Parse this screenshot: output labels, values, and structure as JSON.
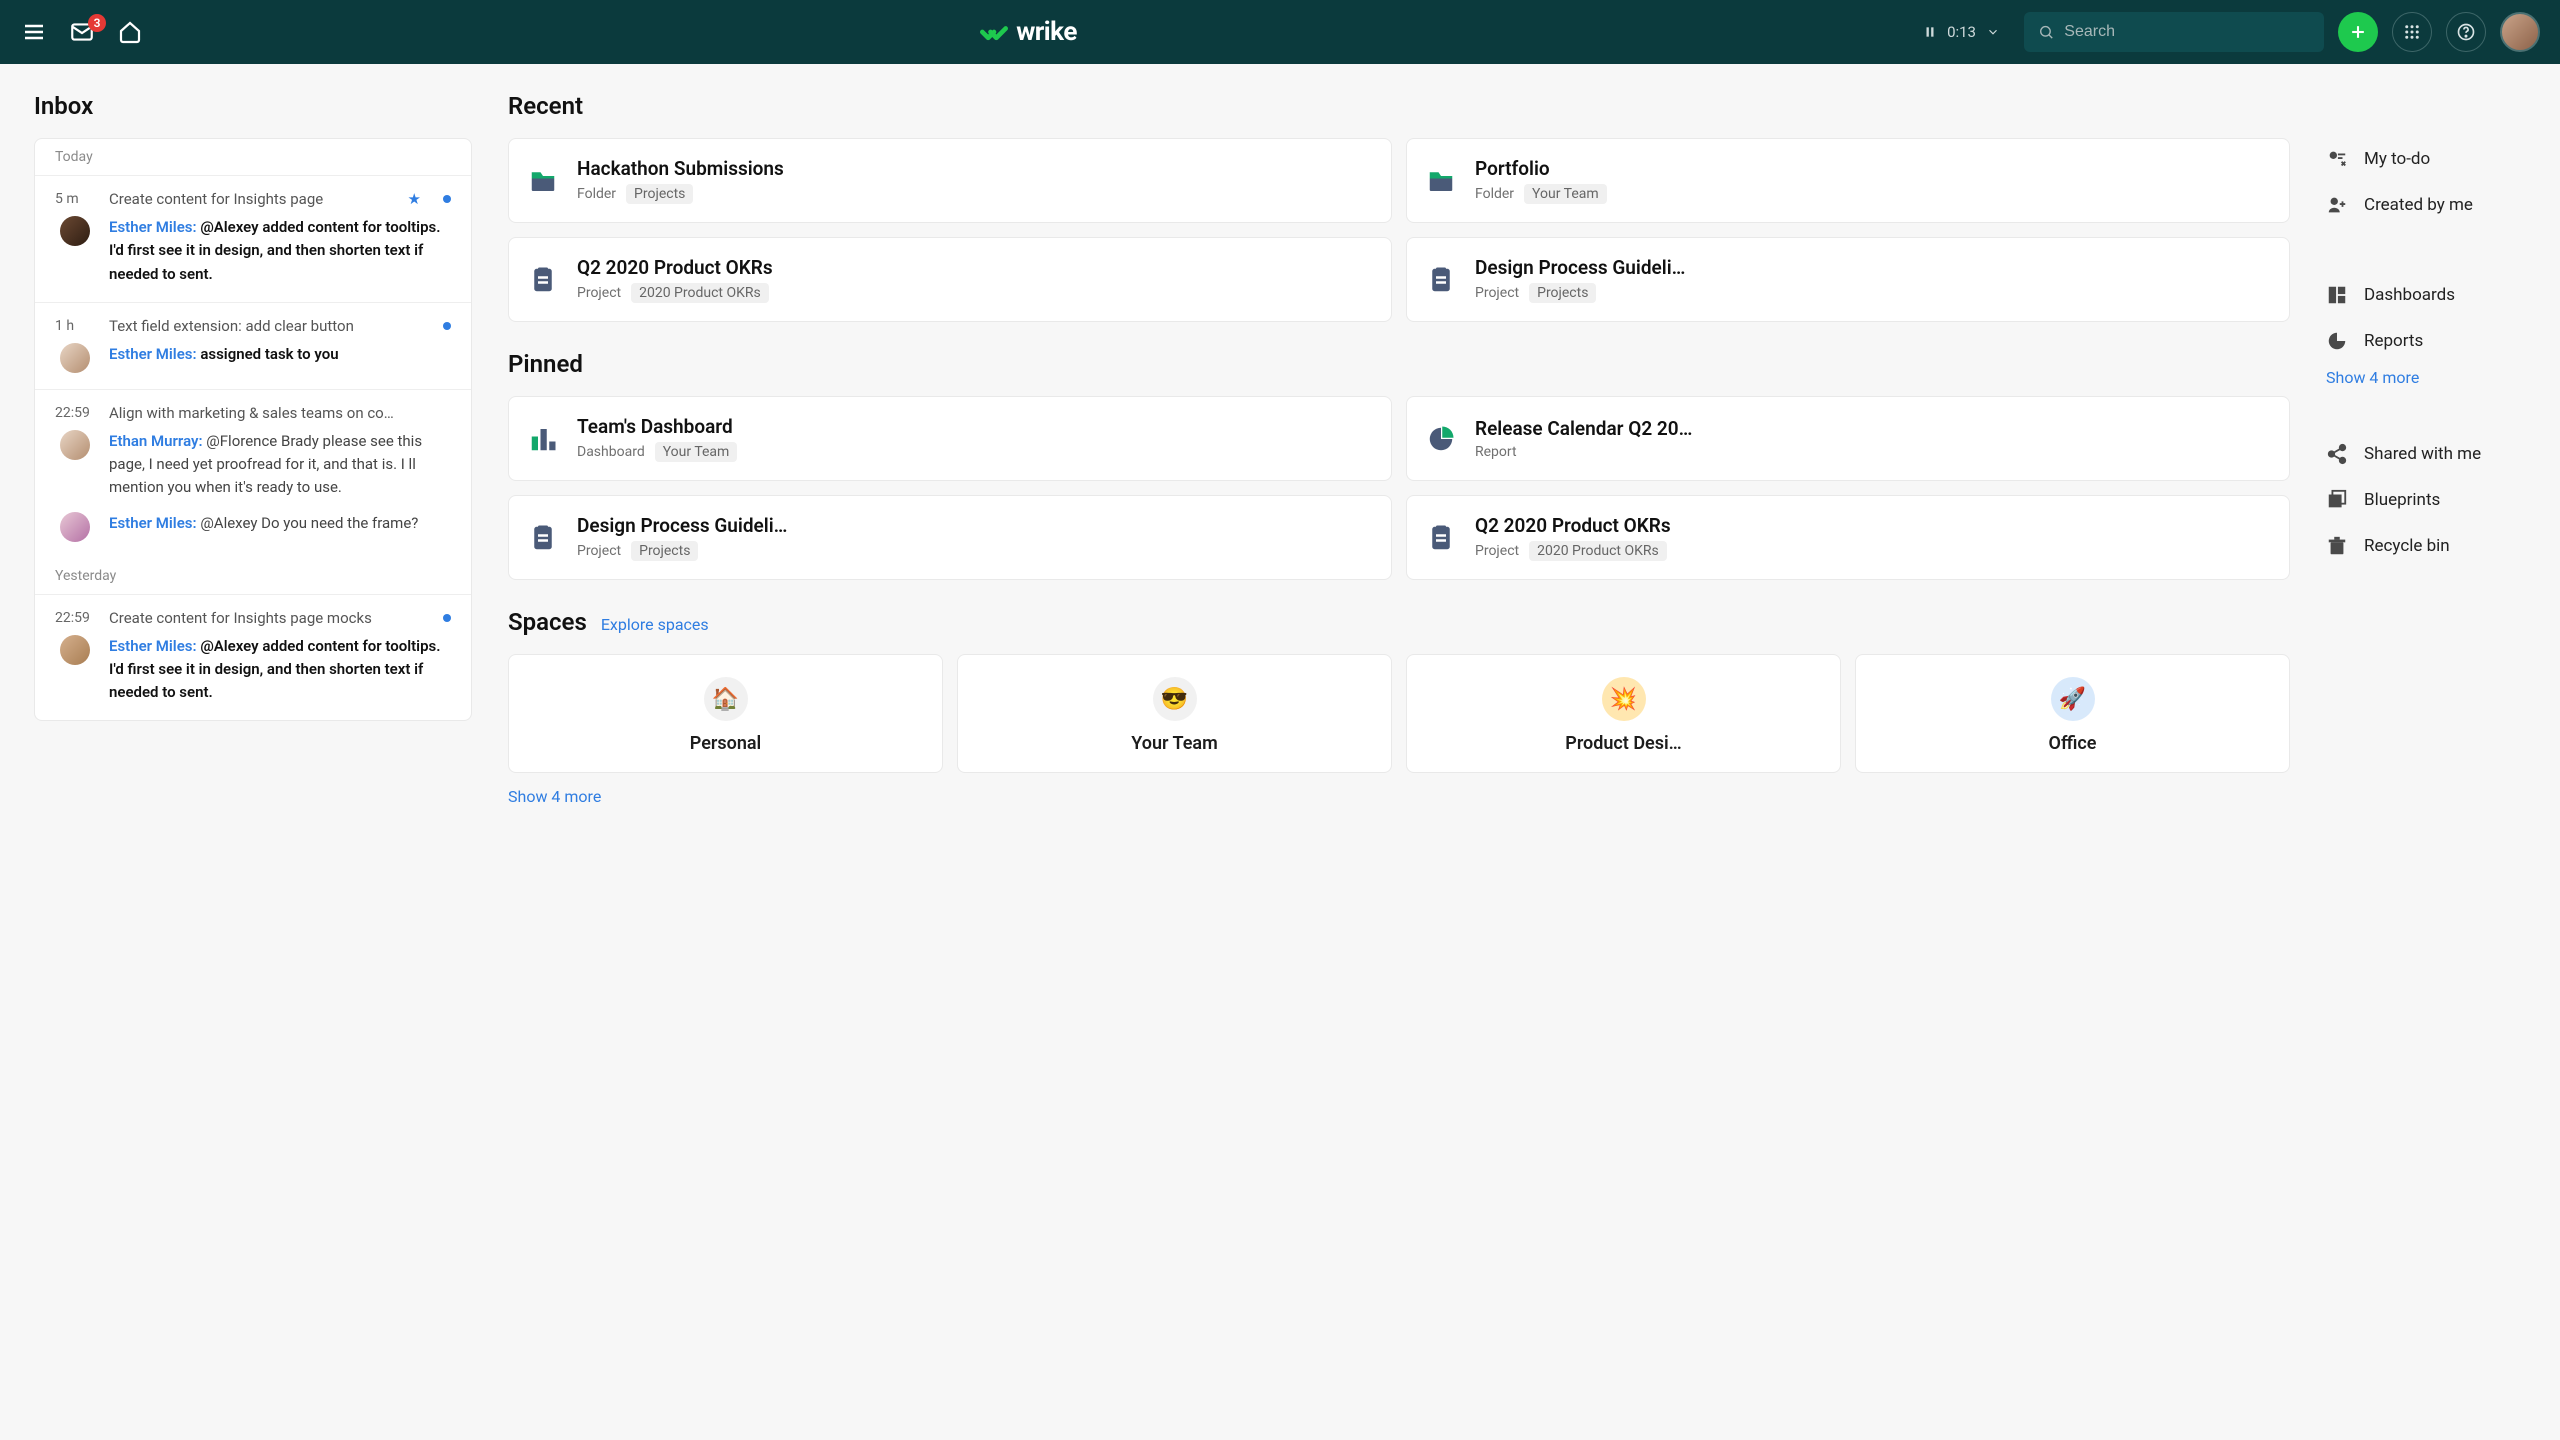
{
  "header": {
    "inbox_badge": "3",
    "brand": "wrike",
    "timer": "0:13",
    "search_placeholder": "Search"
  },
  "inbox": {
    "title": "Inbox",
    "today_label": "Today",
    "yesterday_label": "Yesterday",
    "items": [
      {
        "time": "5 m",
        "title": "Create content for Insights page",
        "starred": true,
        "unread": true,
        "messages": [
          {
            "avatar": "av1",
            "author": "Esther Miles:",
            "bold": "@Alexey added content for tooltips. I'd first see it in design, and then shorten text if needed to sent."
          }
        ]
      },
      {
        "time": "1 h",
        "title": "Text field extension: add clear button",
        "unread": true,
        "messages": [
          {
            "avatar": "av2",
            "author": "Esther Miles:",
            "bold": "assigned task to you"
          }
        ]
      },
      {
        "time": "22:59",
        "title": "Align with marketing & sales teams on co…",
        "messages": [
          {
            "avatar": "av2",
            "author": "Ethan Murray:",
            "text": "@Florence Brady please see this page, I need yet proofread for it, and that is. I ll mention you when it's ready to use."
          },
          {
            "avatar": "av3",
            "author": "Esther Miles:",
            "text": "@Alexey Do you need the frame?"
          }
        ]
      },
      {
        "time": "22:59",
        "title": "Create content for Insights page mocks",
        "unread": true,
        "day": "yesterday",
        "messages": [
          {
            "avatar": "av4",
            "author": "Esther Miles:",
            "bold": "@Alexey added content for tooltips. I'd first see it in design, and then shorten text if needed to sent."
          }
        ]
      }
    ]
  },
  "recent": {
    "title": "Recent",
    "items": [
      {
        "icon": "folder",
        "title": "Hackathon Submissions",
        "type": "Folder",
        "chip": "Projects"
      },
      {
        "icon": "folder",
        "title": "Portfolio",
        "type": "Folder",
        "chip": "Your Team"
      },
      {
        "icon": "project",
        "title": "Q2 2020 Product OKRs",
        "type": "Project",
        "chip": "2020 Product OKRs"
      },
      {
        "icon": "project",
        "title": "Design Process Guideli…",
        "type": "Project",
        "chip": "Projects"
      }
    ]
  },
  "pinned": {
    "title": "Pinned",
    "items": [
      {
        "icon": "dashboard",
        "title": "Team's Dashboard",
        "type": "Dashboard",
        "chip": "Your Team"
      },
      {
        "icon": "report",
        "title": "Release Calendar Q2 20…",
        "type": "Report",
        "chip": ""
      },
      {
        "icon": "project",
        "title": "Design Process Guideli…",
        "type": "Project",
        "chip": "Projects"
      },
      {
        "icon": "project",
        "title": "Q2 2020 Product OKRs",
        "type": "Project",
        "chip": "2020 Product OKRs"
      }
    ]
  },
  "spaces": {
    "title": "Spaces",
    "explore": "Explore spaces",
    "show_more": "Show 4 more",
    "items": [
      {
        "emoji": "🏠",
        "name": "Personal",
        "cls": ""
      },
      {
        "emoji": "😎",
        "name": "Your Team",
        "cls": ""
      },
      {
        "emoji": "💥",
        "name": "Product Desi…",
        "cls": "yellow"
      },
      {
        "emoji": "🚀",
        "name": "Office",
        "cls": "blue"
      }
    ]
  },
  "side": {
    "group1": [
      {
        "icon": "todo",
        "label": "My to-do"
      },
      {
        "icon": "created",
        "label": "Created by me"
      }
    ],
    "group2": [
      {
        "icon": "dashboards",
        "label": "Dashboards"
      },
      {
        "icon": "reports",
        "label": "Reports"
      }
    ],
    "show_more": "Show 4 more",
    "group3": [
      {
        "icon": "shared",
        "label": "Shared with me"
      },
      {
        "icon": "blueprints",
        "label": "Blueprints"
      },
      {
        "icon": "recycle",
        "label": "Recycle bin"
      }
    ]
  }
}
